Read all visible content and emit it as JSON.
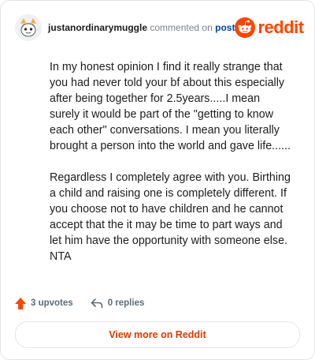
{
  "header": {
    "username": "justanordinarymuggle",
    "action_text": "commented on",
    "post_link": "post",
    "brand": "reddit"
  },
  "comment": {
    "paragraphs": [
      "In my honest opinion I find it really strange that you had never told your bf about this especially after being together for 2.5years.....I mean surely it would be part of the \"getting to know each other\" conversations. I mean you literally brought a person into the world and gave life......",
      "Regardless I completely agree with you. Birthing a child and raising one is completely different. If you choose not to have children and he cannot accept that the it may be time to part ways and let him have the opportunity with someone else. NTA"
    ]
  },
  "footer": {
    "upvotes": "3 upvotes",
    "replies": "0 replies"
  },
  "button": {
    "label": "View more on Reddit"
  },
  "colors": {
    "reddit_orange": "#ff4500",
    "link_blue": "#0045ac",
    "button_text": "#d93a00"
  },
  "icons": {
    "avatar": "snoo-avatar-icon",
    "brand": "reddit-logo-icon",
    "upvote": "upvote-arrow-icon",
    "reply": "reply-arrow-icon"
  }
}
